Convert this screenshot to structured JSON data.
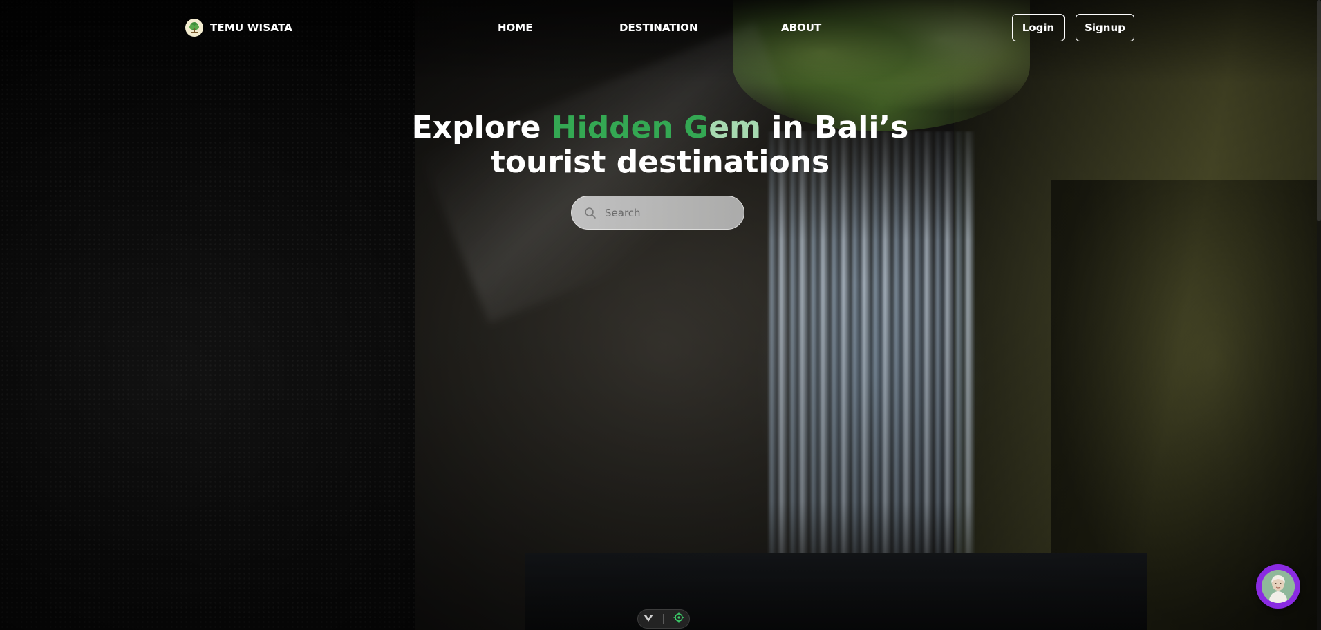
{
  "brand": {
    "name": "TEMU WISATA",
    "logo_icon": "tree-logo-icon"
  },
  "nav": {
    "links": [
      {
        "label": "HOME"
      },
      {
        "label": "DESTINATION"
      },
      {
        "label": "ABOUT"
      }
    ],
    "login_label": "Login",
    "signup_label": "Signup"
  },
  "hero": {
    "title_part1": "Explore ",
    "title_accent1": "Hidden G",
    "title_accent2": "em",
    "title_part2": " in Bali’s tourist destinations",
    "accent_colors": [
      "#34a853",
      "#a6d9b0"
    ]
  },
  "search": {
    "placeholder": "Search",
    "value": "",
    "icon": "search-icon"
  },
  "toolbar": {
    "icons": [
      "v-logo-icon",
      "target-icon"
    ]
  },
  "chat": {
    "icon": "assistant-avatar",
    "accent": "#8a2be2"
  }
}
